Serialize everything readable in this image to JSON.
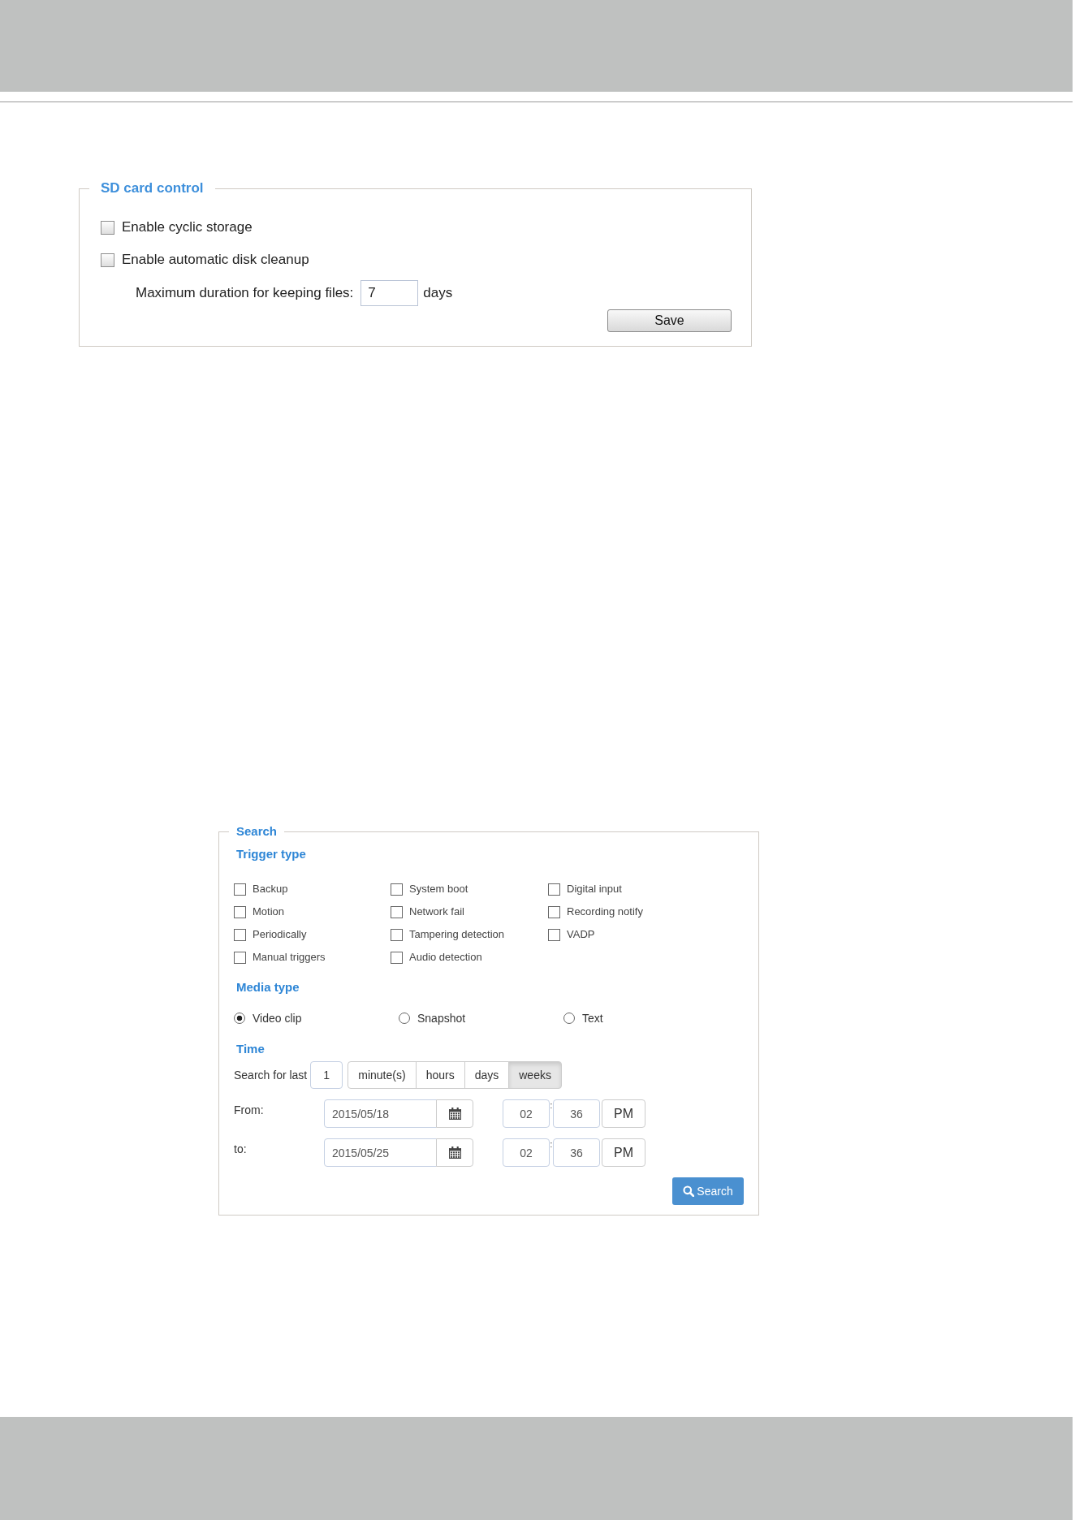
{
  "sd_card_control": {
    "title": "SD card control",
    "options": [
      {
        "label": "Enable cyclic storage",
        "checked": false
      },
      {
        "label": "Enable automatic disk cleanup",
        "checked": false
      }
    ],
    "max_duration": {
      "label": "Maximum duration for keeping files:",
      "value": "7",
      "unit": "days"
    },
    "save_button": "Save"
  },
  "search": {
    "title": "Search",
    "trigger_type": {
      "heading": "Trigger type",
      "options": [
        {
          "label": "Backup",
          "checked": false
        },
        {
          "label": "System boot",
          "checked": false
        },
        {
          "label": "Digital input",
          "checked": false
        },
        {
          "label": "Motion",
          "checked": false
        },
        {
          "label": "Network fail",
          "checked": false
        },
        {
          "label": "Recording notify",
          "checked": false
        },
        {
          "label": "Periodically",
          "checked": false
        },
        {
          "label": "Tampering detection",
          "checked": false
        },
        {
          "label": "VADP",
          "checked": false
        },
        {
          "label": "Manual triggers",
          "checked": false
        },
        {
          "label": "Audio detection",
          "checked": false
        }
      ]
    },
    "media_type": {
      "heading": "Media type",
      "options": [
        {
          "label": "Video clip",
          "selected": true
        },
        {
          "label": "Snapshot",
          "selected": false
        },
        {
          "label": "Text",
          "selected": false
        }
      ]
    },
    "time": {
      "heading": "Time",
      "search_for_last": {
        "label": "Search for last",
        "value": "1",
        "units": [
          {
            "label": "minute(s)",
            "selected": false
          },
          {
            "label": "hours",
            "selected": false
          },
          {
            "label": "days",
            "selected": false
          },
          {
            "label": "weeks",
            "selected": true
          }
        ]
      },
      "ranges": [
        {
          "label": "From:",
          "date": "2015/05/18",
          "hour": "02",
          "separator": ":",
          "minute": "36",
          "period": "PM"
        },
        {
          "label": "to:",
          "date": "2015/05/25",
          "hour": "02",
          "separator": ":",
          "minute": "36",
          "period": "PM"
        }
      ]
    },
    "search_button": "Search"
  }
}
